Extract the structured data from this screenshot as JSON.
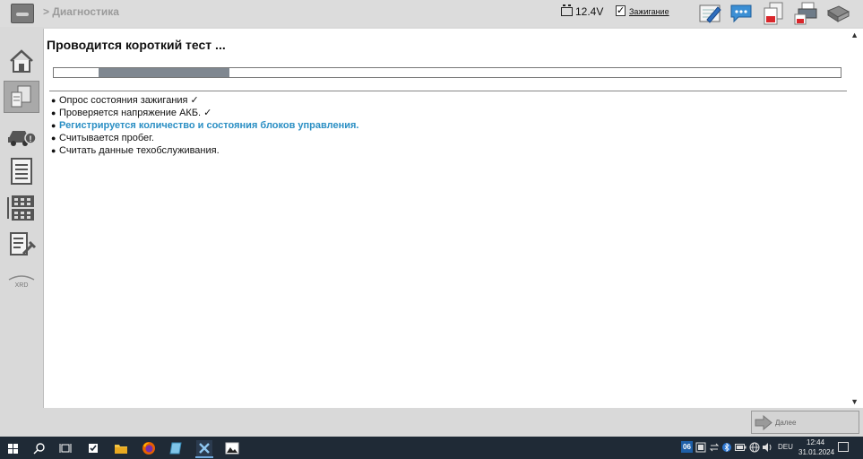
{
  "topbar": {
    "breadcrumb": "> Диагностика",
    "voltage": "12.4V",
    "ignition_checked": true,
    "ignition_label": "Зажигание",
    "icons": [
      "edit-icon",
      "chat-icon",
      "pdf-document-icon",
      "print-icon",
      "book-icon"
    ]
  },
  "sidebar": {
    "items": [
      {
        "name": "home-icon",
        "active": false
      },
      {
        "name": "diagnostics-icon",
        "active": true
      },
      {
        "name": "car-fault-icon",
        "active": false
      },
      {
        "name": "list-icon",
        "active": false
      },
      {
        "name": "control-units-icon",
        "active": false
      },
      {
        "name": "service-docs-icon",
        "active": false
      },
      {
        "name": "xrd-icon",
        "active": false,
        "label": "XRD"
      }
    ]
  },
  "main": {
    "title": "Проводится короткий тест ...",
    "progress": {
      "fill_start": 0.057,
      "fill_end": 0.223
    },
    "steps": [
      {
        "text": "Опрос состояния зажигания ✓",
        "active": false
      },
      {
        "text": "Проверяется напряжение АКБ. ✓",
        "active": false
      },
      {
        "text": "Регистрируется количество и состояния блоков управления.",
        "active": true
      },
      {
        "text": "Считывается пробег.",
        "active": false
      },
      {
        "text": "Считать данные техобслуживания.",
        "active": false
      }
    ]
  },
  "footer": {
    "next_label": "Далее"
  },
  "taskbar": {
    "tray_badge": "06",
    "language": "DEU",
    "time": "12:44",
    "date": "31.01.2024"
  },
  "colors": {
    "active_step": "#2b8fc4",
    "progress_fill": "#7f8790",
    "taskbar_bg": "#1f2a36"
  }
}
